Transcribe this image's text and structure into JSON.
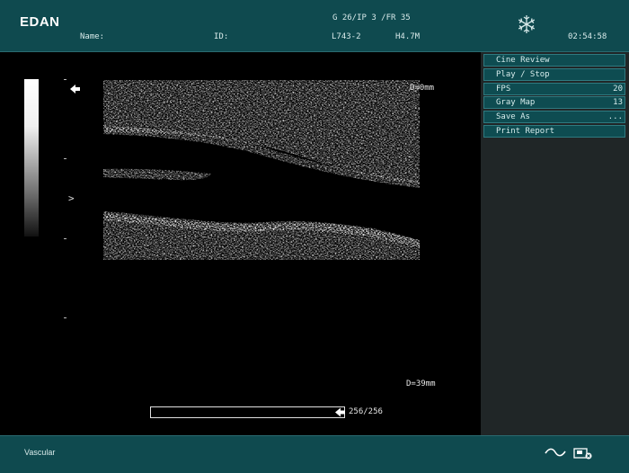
{
  "header": {
    "brand": "EDAN",
    "name_label": "Name:",
    "id_label": "ID:",
    "params": "G 26/IP 3 /FR 35",
    "probe": "L743-2",
    "frequency": "H4.7M",
    "time": "02:54:58",
    "freeze_icon": "snowflake-icon"
  },
  "image": {
    "depth_top": "D=0mm",
    "depth_bottom": "D=39mm",
    "focus_marker": ">",
    "cine_counter": "256/256"
  },
  "menu": {
    "items": [
      {
        "label": "Cine Review",
        "value": ""
      },
      {
        "label": "Play / Stop",
        "value": ""
      },
      {
        "label": "FPS",
        "value": "20"
      },
      {
        "label": "Gray Map",
        "value": "13"
      },
      {
        "label": "Save As",
        "value": "..."
      },
      {
        "label": "Print Report",
        "value": ""
      }
    ]
  },
  "footer": {
    "exam_mode": "Vascular",
    "wave_icon": "tilde-wave-icon",
    "probe_icon": "probe-icon"
  },
  "colors": {
    "panel_teal": "#0f4a4f",
    "menu_teal": "#0e4c51",
    "side_panel": "#202627"
  }
}
